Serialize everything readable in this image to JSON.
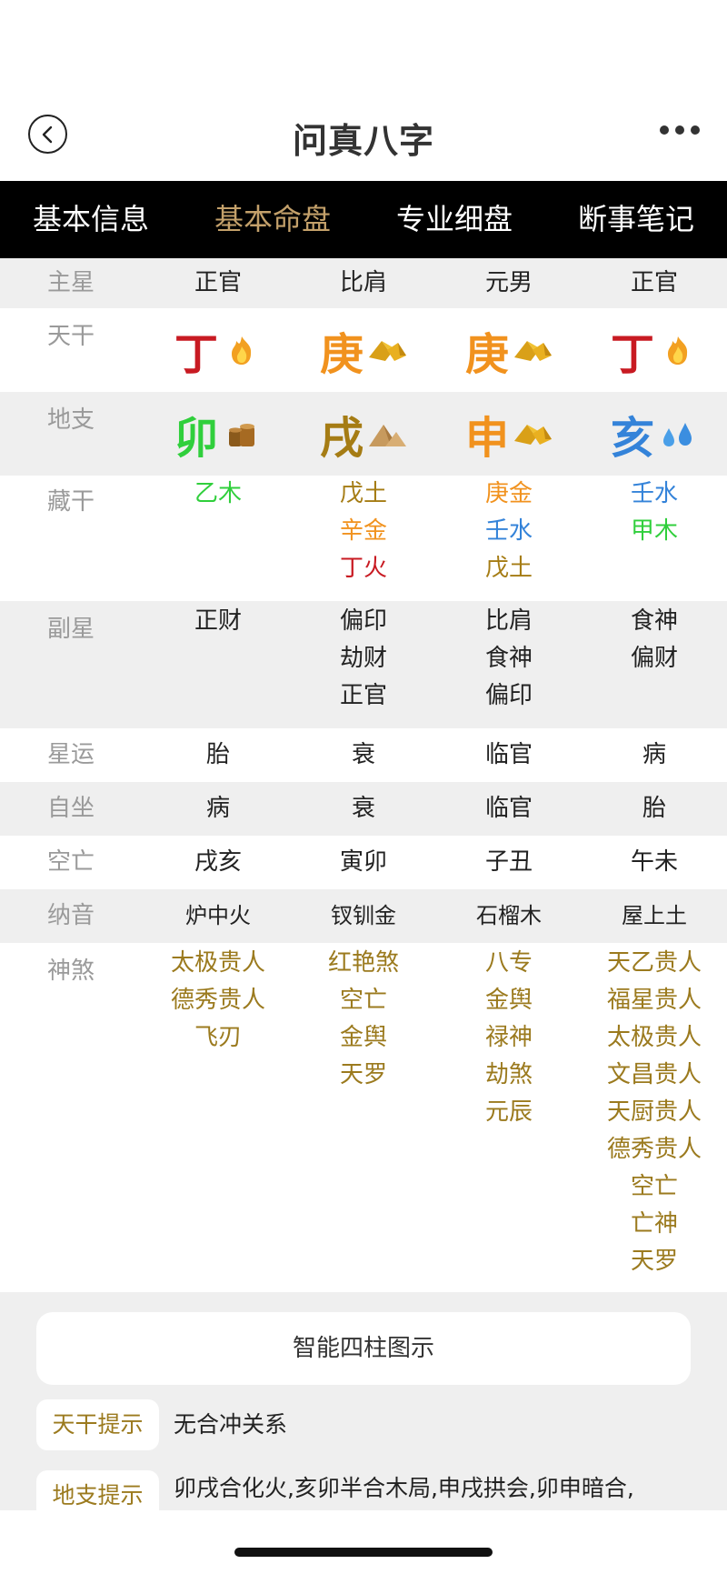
{
  "nav": {
    "title": "问真八字"
  },
  "tabs": [
    {
      "label": "基本信息",
      "active": false
    },
    {
      "label": "基本命盘",
      "active": true
    },
    {
      "label": "专业细盘",
      "active": false
    },
    {
      "label": "断事笔记",
      "active": false
    }
  ],
  "rows": {
    "main_star": {
      "label": "主星",
      "values": [
        "正官",
        "比肩",
        "元男",
        "正官"
      ]
    },
    "tiangan": {
      "label": "天干",
      "values": [
        "丁",
        "庚",
        "庚",
        "丁"
      ],
      "icons": [
        "fire-icon",
        "metal-icon",
        "metal-icon",
        "fire-icon"
      ]
    },
    "dizhi": {
      "label": "地支",
      "values": [
        "卯",
        "戌",
        "申",
        "亥"
      ],
      "icons": [
        "wood-icon",
        "earth-icon",
        "metal-icon",
        "water-icon"
      ]
    },
    "canggan": {
      "label": "藏干",
      "values": [
        [
          "乙木"
        ],
        [
          "戊土",
          "辛金",
          "丁火"
        ],
        [
          "庚金",
          "壬水",
          "戊土"
        ],
        [
          "壬水",
          "甲木"
        ]
      ]
    },
    "fuxing": {
      "label": "副星",
      "values": [
        [
          "正财"
        ],
        [
          "偏印",
          "劫财",
          "正官"
        ],
        [
          "比肩",
          "食神",
          "偏印"
        ],
        [
          "食神",
          "偏财"
        ]
      ]
    },
    "xingyun": {
      "label": "星运",
      "values": [
        "胎",
        "衰",
        "临官",
        "病"
      ]
    },
    "zizuo": {
      "label": "自坐",
      "values": [
        "病",
        "衰",
        "临官",
        "胎"
      ]
    },
    "kongwang": {
      "label": "空亡",
      "values": [
        "戌亥",
        "寅卯",
        "子丑",
        "午未"
      ]
    },
    "nayin": {
      "label": "纳音",
      "values": [
        "炉中火",
        "钗钏金",
        "石榴木",
        "屋上土"
      ]
    },
    "shensha": {
      "label": "神煞",
      "values": [
        [
          "太极贵人",
          "德秀贵人",
          "飞刃"
        ],
        [
          "红艳煞",
          "空亡",
          "金舆",
          "天罗"
        ],
        [
          "八专",
          "金舆",
          "禄神",
          "劫煞",
          "元辰"
        ],
        [
          "天乙贵人",
          "福星贵人",
          "太极贵人",
          "文昌贵人",
          "天厨贵人",
          "德秀贵人",
          "空亡",
          "亡神",
          "天罗"
        ]
      ]
    }
  },
  "smart_button": "智能四柱图示",
  "hints": [
    {
      "tag": "天干提示",
      "text": "无合冲关系"
    },
    {
      "tag": "地支提示",
      "text": "卯戌合化火,亥卯半合木局,申戌拱会,卯申暗合,申亥相害"
    }
  ],
  "colors": {
    "accent": "#c3a06a",
    "fire": "#c81a22",
    "metal": "#f1921e",
    "wood": "#30cf3c",
    "earth": "#a57c14",
    "water": "#3483d9",
    "shensha": "#9b7a1e"
  }
}
